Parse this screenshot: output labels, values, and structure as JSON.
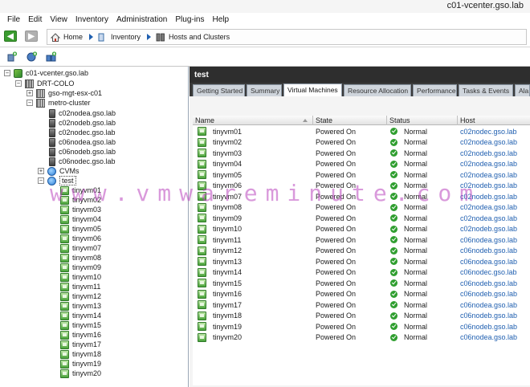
{
  "window": {
    "title": "c01-vcenter.gso.lab"
  },
  "menu": [
    "File",
    "Edit",
    "View",
    "Inventory",
    "Administration",
    "Plug-ins",
    "Help"
  ],
  "breadcrumb": [
    "Home",
    "Inventory",
    "Hosts and Clusters"
  ],
  "toolbar": {
    "icons": [
      "new-host-icon",
      "new-datacenter-icon",
      "new-cluster-icon"
    ]
  },
  "tree": {
    "root": "c01-vcenter.gso.lab",
    "datacenter": "DRT-COLO",
    "standalone_host": "gso-mgt-esx-c01",
    "cluster": "metro-cluster",
    "cluster_hosts": [
      "c02nodea.gso.lab",
      "c02nodeb.gso.lab",
      "c02nodec.gso.lab",
      "c06nodea.gso.lab",
      "c06nodeb.gso.lab",
      "c06nodec.gso.lab"
    ],
    "pools": [
      "CVMs",
      "test"
    ],
    "vms": [
      "tinyvm01",
      "tinyvm02",
      "tinyvm03",
      "tinyvm04",
      "tinyvm05",
      "tinyvm06",
      "tinyvm07",
      "tinyvm08",
      "tinyvm09",
      "tinyvm10",
      "tinyvm11",
      "tinyvm12",
      "tinyvm13",
      "tinyvm14",
      "tinyvm15",
      "tinyvm16",
      "tinyvm17",
      "tinyvm18",
      "tinyvm19",
      "tinyvm20"
    ]
  },
  "object": {
    "title": "test",
    "tabs": [
      "Getting Started",
      "Summary",
      "Virtual Machines",
      "Resource Allocation",
      "Performance",
      "Tasks & Events",
      "Ala"
    ],
    "active_tab": "Virtual Machines"
  },
  "table": {
    "columns": [
      "Name",
      "State",
      "Status",
      "Host"
    ],
    "rows": [
      {
        "name": "tinyvm01",
        "state": "Powered On",
        "status": "Normal",
        "host": "c02nodec.gso.lab"
      },
      {
        "name": "tinyvm02",
        "state": "Powered On",
        "status": "Normal",
        "host": "c02nodea.gso.lab"
      },
      {
        "name": "tinyvm03",
        "state": "Powered On",
        "status": "Normal",
        "host": "c02nodeb.gso.lab"
      },
      {
        "name": "tinyvm04",
        "state": "Powered On",
        "status": "Normal",
        "host": "c02nodea.gso.lab"
      },
      {
        "name": "tinyvm05",
        "state": "Powered On",
        "status": "Normal",
        "host": "c02nodea.gso.lab"
      },
      {
        "name": "tinyvm06",
        "state": "Powered On",
        "status": "Normal",
        "host": "c02nodeb.gso.lab"
      },
      {
        "name": "tinyvm07",
        "state": "Powered On",
        "status": "Normal",
        "host": "c02nodeb.gso.lab"
      },
      {
        "name": "tinyvm08",
        "state": "Powered On",
        "status": "Normal",
        "host": "c02nodea.gso.lab"
      },
      {
        "name": "tinyvm09",
        "state": "Powered On",
        "status": "Normal",
        "host": "c02nodea.gso.lab"
      },
      {
        "name": "tinyvm10",
        "state": "Powered On",
        "status": "Normal",
        "host": "c02nodeb.gso.lab"
      },
      {
        "name": "tinyvm11",
        "state": "Powered On",
        "status": "Normal",
        "host": "c06nodea.gso.lab"
      },
      {
        "name": "tinyvm12",
        "state": "Powered On",
        "status": "Normal",
        "host": "c06nodeb.gso.lab"
      },
      {
        "name": "tinyvm13",
        "state": "Powered On",
        "status": "Normal",
        "host": "c06nodea.gso.lab"
      },
      {
        "name": "tinyvm14",
        "state": "Powered On",
        "status": "Normal",
        "host": "c06nodec.gso.lab"
      },
      {
        "name": "tinyvm15",
        "state": "Powered On",
        "status": "Normal",
        "host": "c06nodeb.gso.lab"
      },
      {
        "name": "tinyvm16",
        "state": "Powered On",
        "status": "Normal",
        "host": "c06nodeb.gso.lab"
      },
      {
        "name": "tinyvm17",
        "state": "Powered On",
        "status": "Normal",
        "host": "c06nodea.gso.lab"
      },
      {
        "name": "tinyvm18",
        "state": "Powered On",
        "status": "Normal",
        "host": "c06nodeb.gso.lab"
      },
      {
        "name": "tinyvm19",
        "state": "Powered On",
        "status": "Normal",
        "host": "c06nodeb.gso.lab"
      },
      {
        "name": "tinyvm20",
        "state": "Powered On",
        "status": "Normal",
        "host": "c06nodea.gso.lab"
      }
    ]
  },
  "watermark": "www.vmwareminute.com"
}
